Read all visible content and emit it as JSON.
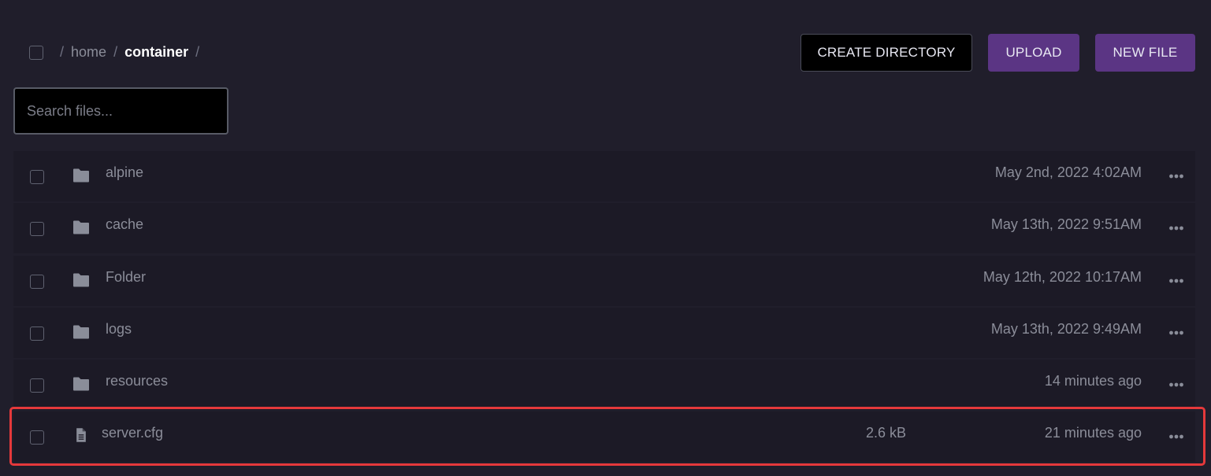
{
  "breadcrumb": {
    "separator": "/",
    "items": [
      {
        "label": "home",
        "current": false
      },
      {
        "label": "container",
        "current": true
      }
    ]
  },
  "toolbar": {
    "create_directory_label": "CREATE DIRECTORY",
    "upload_label": "UPLOAD",
    "new_file_label": "NEW FILE"
  },
  "search": {
    "placeholder": "Search files...",
    "value": ""
  },
  "colors": {
    "background": "#201e2b",
    "row_background": "#1c1a26",
    "accent_purple": "#5b3584",
    "highlight_red": "#e5393b"
  },
  "files": [
    {
      "name": "alpine",
      "type": "folder",
      "icon": "folder-icon",
      "size": "",
      "modified": "May 2nd, 2022 4:02AM"
    },
    {
      "name": "cache",
      "type": "folder",
      "icon": "folder-icon",
      "size": "",
      "modified": "May 13th, 2022 9:51AM"
    },
    {
      "name": "Folder",
      "type": "folder",
      "icon": "folder-icon",
      "size": "",
      "modified": "May 12th, 2022 10:17AM"
    },
    {
      "name": "logs",
      "type": "folder",
      "icon": "folder-icon",
      "size": "",
      "modified": "May 13th, 2022 9:49AM"
    },
    {
      "name": "resources",
      "type": "folder",
      "icon": "folder-icon",
      "size": "",
      "modified": "14 minutes ago"
    },
    {
      "name": "server.cfg",
      "type": "file",
      "icon": "file-text-icon",
      "size": "2.6 kB",
      "modified": "21 minutes ago",
      "highlighted": true
    }
  ]
}
